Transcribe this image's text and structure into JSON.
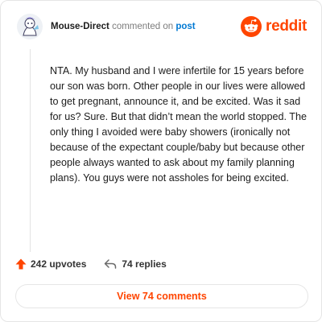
{
  "header": {
    "username": "Mouse-Direct",
    "action": "commented on",
    "post_link": "post",
    "brand": "reddit"
  },
  "comment": {
    "body": "NTA. My husband and I were infertile for 15 years before our son was born. Other people in our lives were allowed to get pregnant, announce it, and be excited. Was it sad for us? Sure. But that didn’t mean the world stopped. The only thing I avoided were baby showers (ironically not because of the expectant couple/baby but because other people always wanted to ask about my family planning plans). You guys were not assholes for being excited."
  },
  "footer": {
    "upvotes": "242 upvotes",
    "replies": "74 replies"
  },
  "view_button": "View 74 comments",
  "colors": {
    "accent": "#ff4500",
    "link": "#0079d3"
  },
  "icons": [
    "snoo-avatar-icon",
    "reddit-logo-icon",
    "upvote-arrow-icon",
    "reply-arrow-icon"
  ]
}
